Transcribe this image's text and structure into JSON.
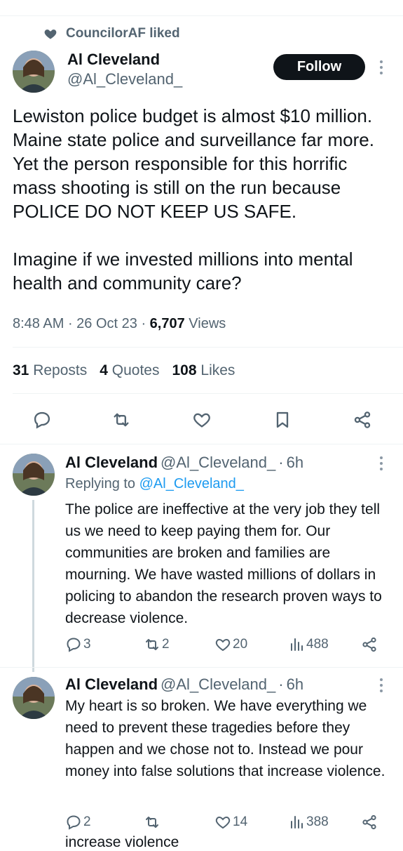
{
  "social_context": {
    "label": "CouncilorAF liked",
    "icon": "heart-icon"
  },
  "main_tweet": {
    "author_name": "Al Cleveland",
    "author_handle": "@Al_Cleveland_",
    "follow_label": "Follow",
    "text": "Lewiston police budget is almost $10 million. Maine state police and surveillance far more. Yet the person responsible for this horrific mass shooting is still on the run because POLICE DO NOT KEEP US SAFE.\n\nImagine if we invested millions into mental health and community care?",
    "time": "8:48 AM",
    "date": "26 Oct 23",
    "views_count": "6,707",
    "views_label": "Views",
    "reposts_count": "31",
    "reposts_label": "Reposts",
    "quotes_count": "4",
    "quotes_label": "Quotes",
    "likes_count": "108",
    "likes_label": "Likes"
  },
  "replies": [
    {
      "author_name": "Al Cleveland",
      "author_handle": "@Al_Cleveland_",
      "age": "6h",
      "replying_prefix": "Replying to",
      "replying_to": "@Al_Cleveland_",
      "text": "The police are ineffective at the very job they tell us we need to keep paying them for. Our communities are broken and families are mourning. We have wasted millions of dollars in policing to abandon the research proven ways to decrease violence.",
      "reply_count": "3",
      "repost_count": "2",
      "like_count": "20",
      "view_count": "488"
    },
    {
      "author_name": "Al Cleveland",
      "author_handle": "@Al_Cleveland_",
      "age": "6h",
      "text": "My heart is so broken. We have everything we need to prevent these tragedies before they happen and we chose not to. Instead we pour money into false solutions that increase violence.",
      "reply_count": "2",
      "repost_count": "",
      "like_count": "14",
      "view_count": "388"
    }
  ],
  "cut_off_text": "increase violence",
  "colors": {
    "accent": "#1d9bf0",
    "text": "#0f1419",
    "secondary": "#536471"
  }
}
